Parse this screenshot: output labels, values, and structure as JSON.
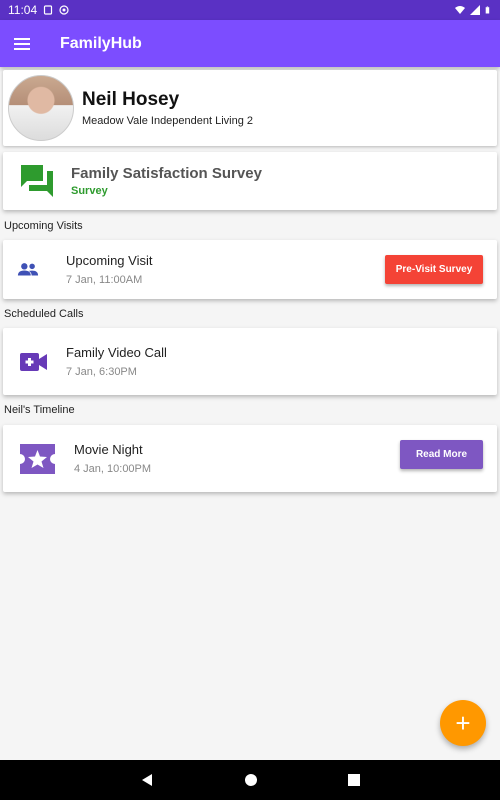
{
  "status_bar": {
    "time": "11:04",
    "icons": [
      "sim-card-icon",
      "media-icon",
      "wifi-icon",
      "signal-icon",
      "battery-icon"
    ]
  },
  "app_bar": {
    "title": "FamilyHub",
    "menu_icon": "hamburger-menu-icon"
  },
  "profile": {
    "name": "Neil Hosey",
    "location": "Meadow Vale Independent Living 2"
  },
  "survey_card": {
    "title": "Family Satisfaction Survey",
    "subtitle": "Survey",
    "icon": "chat-bubbles-icon",
    "icon_color": "#2e9b2e"
  },
  "sections": {
    "upcoming_visits": "Upcoming Visits",
    "scheduled_calls": "Scheduled Calls",
    "timeline": "Neil's Timeline"
  },
  "upcoming_visit": {
    "title": "Upcoming Visit",
    "time": "7 Jan, 11:00AM",
    "button": "Pre-Visit Survey",
    "icon": "people-icon",
    "button_color": "#f44336"
  },
  "scheduled_call": {
    "title": "Family Video Call",
    "time": "7 Jan, 6:30PM",
    "icon": "video-call-icon"
  },
  "timeline_item": {
    "title": "Movie Night",
    "time": "4 Jan, 10:00PM",
    "button": "Read More",
    "icon": "ticket-star-icon",
    "button_color": "#7e57c2"
  },
  "fab": {
    "label": "+"
  },
  "nav": [
    "back-icon",
    "home-icon",
    "recents-icon"
  ]
}
